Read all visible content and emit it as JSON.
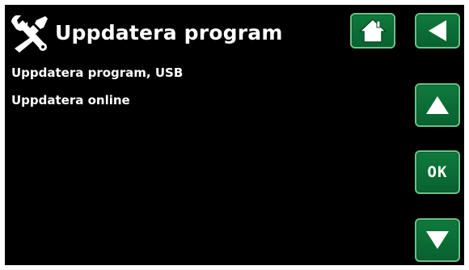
{
  "header": {
    "title": "Uppdatera program",
    "icon": "tools-icon"
  },
  "menu": {
    "items": [
      {
        "label": "Uppdatera program, USB"
      },
      {
        "label": "Uppdatera online"
      }
    ]
  },
  "buttons": {
    "home_icon": "home-icon",
    "back_icon": "arrow-left-icon",
    "up_icon": "arrow-up-icon",
    "ok_label": "OK",
    "down_icon": "arrow-down-icon"
  },
  "colors": {
    "background": "#000000",
    "button_fill": "#0f7a3c",
    "button_border": "#6bc28a",
    "text": "#ffffff"
  }
}
